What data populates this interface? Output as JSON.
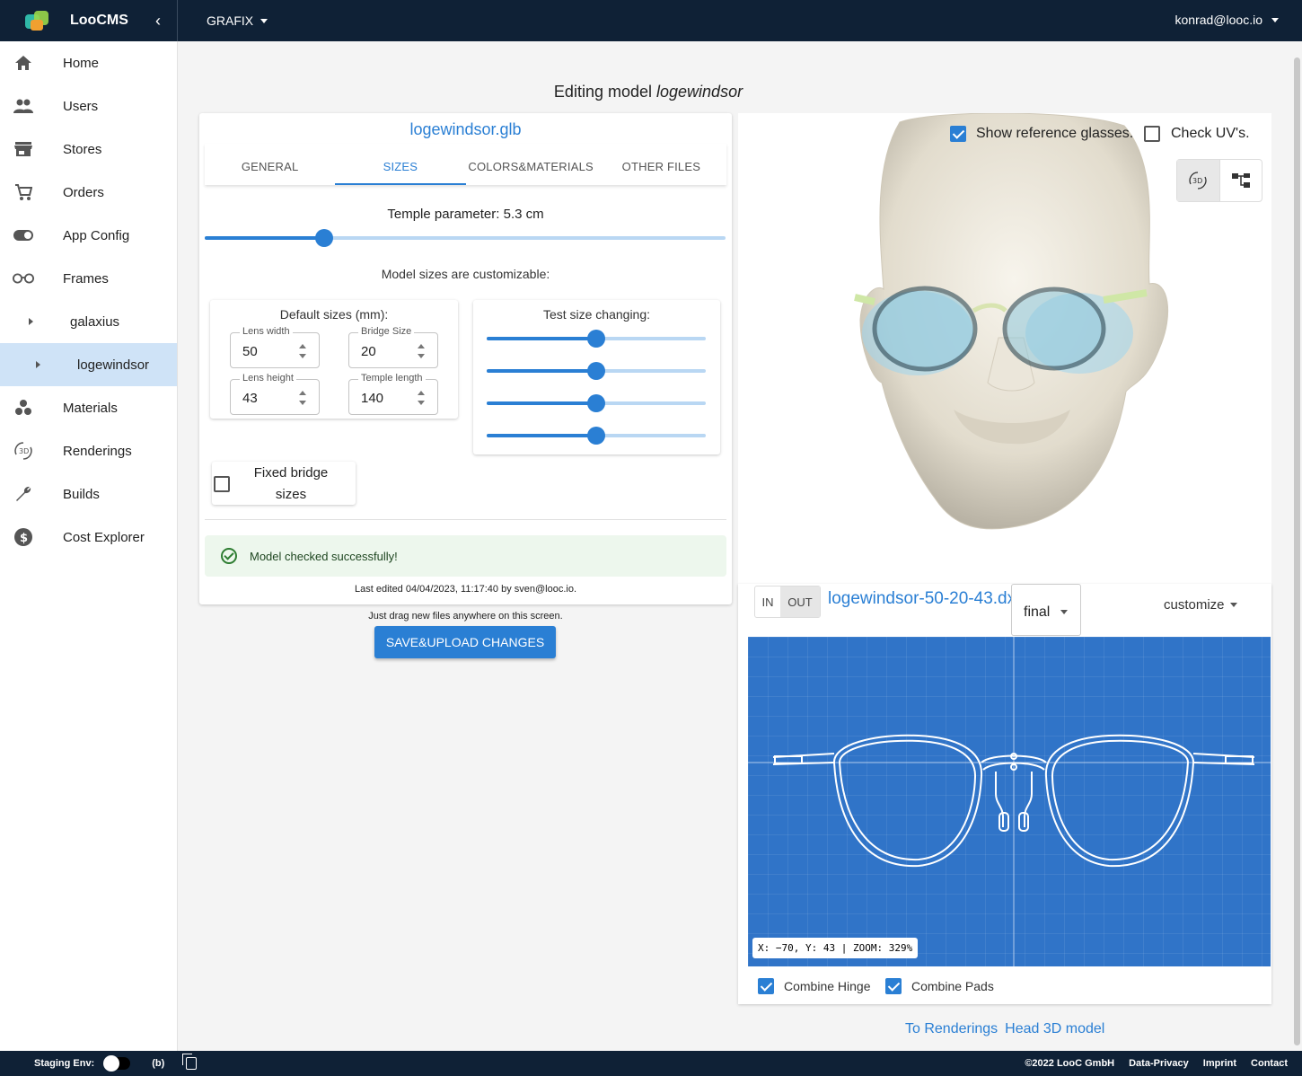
{
  "app": {
    "name": "LooCMS",
    "section_menu": "GRAFIX",
    "user": "konrad@looc.io"
  },
  "sidebar": {
    "items": [
      {
        "label": "Home",
        "icon": "home-icon"
      },
      {
        "label": "Users",
        "icon": "users-icon"
      },
      {
        "label": "Stores",
        "icon": "store-icon"
      },
      {
        "label": "Orders",
        "icon": "cart-icon"
      },
      {
        "label": "App Config",
        "icon": "toggle-icon"
      },
      {
        "label": "Frames",
        "icon": "glasses-icon"
      },
      {
        "label": "galaxius",
        "icon": ""
      },
      {
        "label": "logewindsor",
        "icon": ""
      },
      {
        "label": "Materials",
        "icon": "materials-icon"
      },
      {
        "label": "Renderings",
        "icon": "3d-rotate-icon"
      },
      {
        "label": "Builds",
        "icon": "wrench-icon"
      },
      {
        "label": "Cost Explorer",
        "icon": "dollar-icon"
      }
    ]
  },
  "page": {
    "title_prefix": "Editing model",
    "title_model": "logewindsor"
  },
  "editor": {
    "file": "logewindsor.glb",
    "tabs": [
      "GENERAL",
      "SIZES",
      "COLORS&MATERIALS",
      "OTHER FILES"
    ],
    "active_tab": "SIZES",
    "temple_label": "Temple parameter: 5.3 cm",
    "temple_fraction": 0.23,
    "custom_label": "Model sizes are customizable:",
    "defaults_title": "Default sizes (mm):",
    "fields": {
      "lens_width": {
        "label": "Lens width",
        "value": "50"
      },
      "bridge_size": {
        "label": "Bridge Size",
        "value": "20"
      },
      "lens_height": {
        "label": "Lens height",
        "value": "43"
      },
      "temple_length": {
        "label": "Temple length",
        "value": "140"
      }
    },
    "test_title": "Test size changing:",
    "test_sliders": [
      0.5,
      0.5,
      0.5,
      0.5
    ],
    "fixed_bridge": {
      "label": "Fixed bridge sizes",
      "checked": false
    },
    "alert": "Model checked successfully!",
    "last_edited": "Last edited 04/04/2023, 11:17:40 by sven@looc.io.",
    "drag_note": "Just drag new files anywhere on this screen.",
    "save_label": "SAVE&UPLOAD CHANGES"
  },
  "viewer": {
    "show_reference": {
      "label": "Show reference glasses.",
      "checked": true
    },
    "check_uv": {
      "label": "Check UV's.",
      "checked": false
    },
    "view_3d_label": "3D"
  },
  "dxf": {
    "in_label": "IN",
    "out_label": "OUT",
    "file": "logewindsor-50-20-43.dxf",
    "variant": "final",
    "customize_label": "customize",
    "coord_readout": "X: −70, Y: 43 | ZOOM: 329%",
    "combine_hinge": {
      "label": "Combine Hinge",
      "checked": true
    },
    "combine_pads": {
      "label": "Combine Pads",
      "checked": true
    }
  },
  "links": {
    "renderings": "To Renderings",
    "head_model": "Head 3D model"
  },
  "footer": {
    "staging_label": "Staging Env:",
    "b_label": "(b)",
    "copyright": "©2022 LooC GmbH",
    "privacy": "Data-Privacy",
    "imprint": "Imprint",
    "contact": "Contact"
  },
  "colors": {
    "accent": "#2a7fd4",
    "topbar": "#0f2136",
    "blueprint": "#3074c8",
    "active_nav": "#cfe3f7"
  }
}
